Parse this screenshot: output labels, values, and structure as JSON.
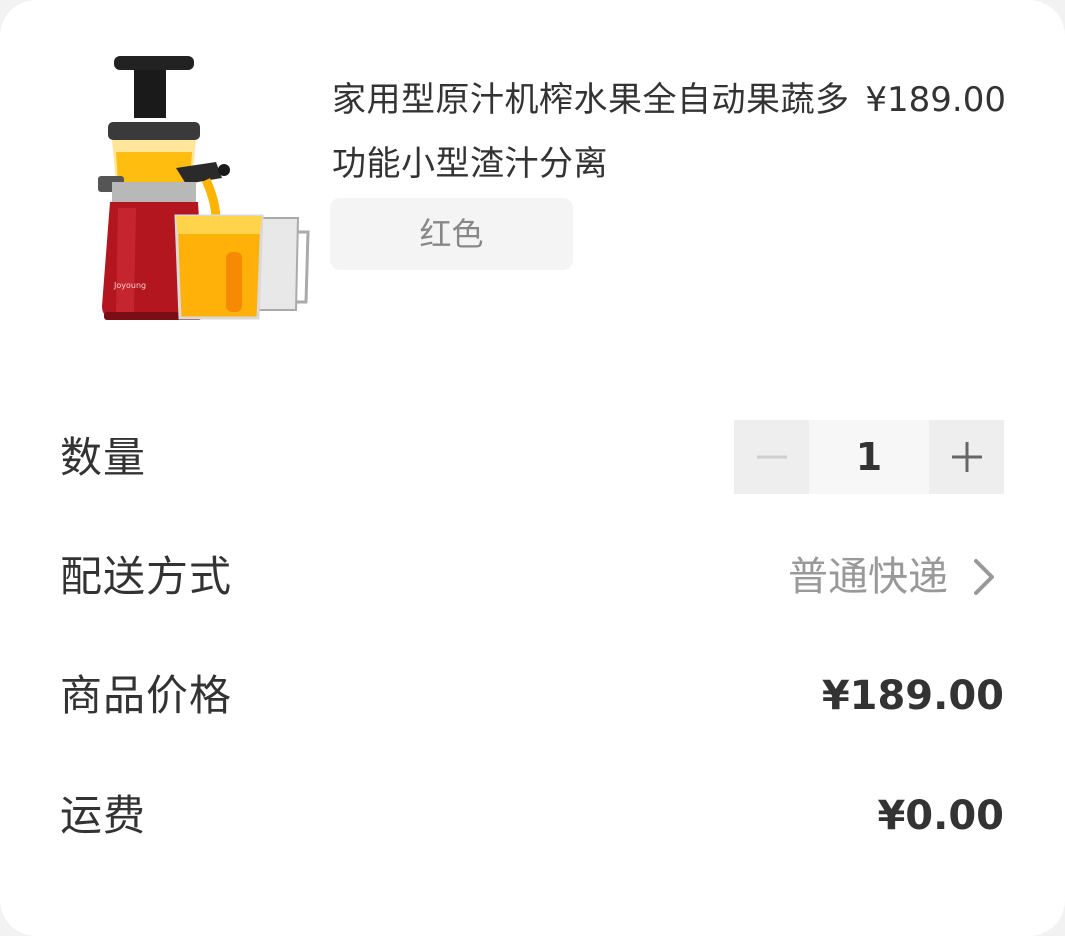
{
  "product": {
    "title": "家用型原汁机榨水果全自动果蔬多功能小型渣汁分离",
    "price": "¥189.00",
    "spec": "红色",
    "image_icon": "juicer-product-image"
  },
  "quantity": {
    "label": "数量",
    "value": "1",
    "decrease_icon": "minus-icon",
    "increase_icon": "plus-icon"
  },
  "shipping": {
    "label": "配送方式",
    "value": "普通快递",
    "icon": "chevron-right-icon"
  },
  "goods_price": {
    "label": "商品价格",
    "value": "¥189.00"
  },
  "freight": {
    "label": "运费",
    "value": "¥0.00"
  },
  "colors": {
    "card_bg": "#ffffff",
    "text": "#333333",
    "muted": "#999999",
    "tag_bg": "#f4f4f4",
    "stepper_bg": "#eeeeee",
    "juicer_red": "#b3161f",
    "juice_orange": "#ffb400"
  }
}
